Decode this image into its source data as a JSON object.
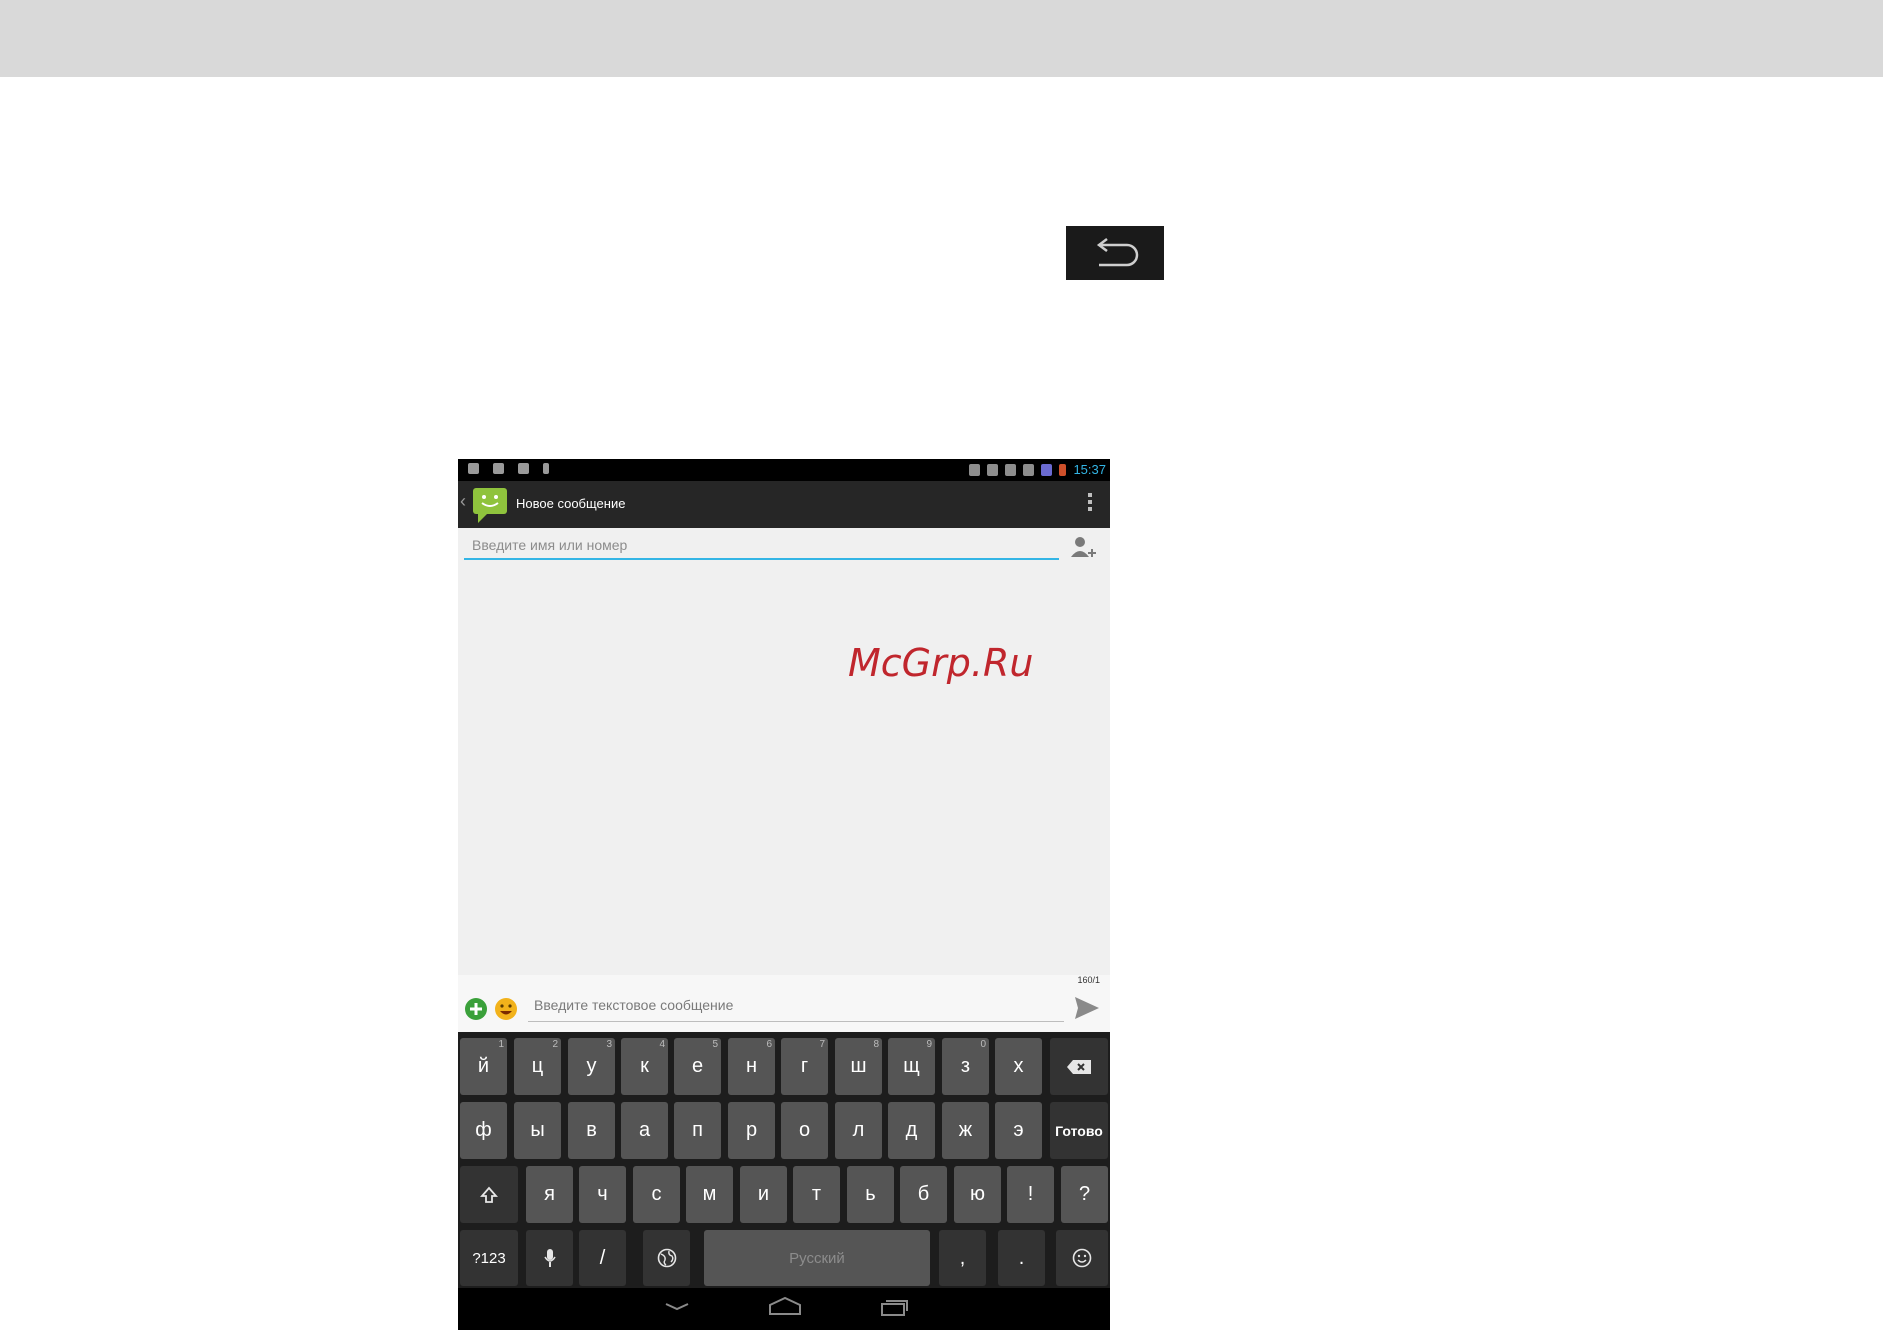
{
  "action_bar": {
    "title": "Новое сообщение"
  },
  "status_bar": {
    "time": "15:37"
  },
  "recipient": {
    "placeholder": "Введите имя или номер"
  },
  "watermark": "McGrp.Ru",
  "compose": {
    "placeholder": "Введите текстовое сообщение",
    "counter": "160/1"
  },
  "keyboard": {
    "row1": [
      {
        "label": "й",
        "hint": "1"
      },
      {
        "label": "ц",
        "hint": "2"
      },
      {
        "label": "у",
        "hint": "3"
      },
      {
        "label": "к",
        "hint": "4"
      },
      {
        "label": "е",
        "hint": "5"
      },
      {
        "label": "н",
        "hint": "6"
      },
      {
        "label": "г",
        "hint": "7"
      },
      {
        "label": "ш",
        "hint": "8"
      },
      {
        "label": "щ",
        "hint": "9"
      },
      {
        "label": "з",
        "hint": "0"
      },
      {
        "label": "х",
        "hint": ""
      }
    ],
    "row2": [
      "ф",
      "ы",
      "в",
      "а",
      "п",
      "р",
      "о",
      "л",
      "д",
      "ж",
      "э"
    ],
    "done_label": "Готово",
    "row3": [
      "я",
      "ч",
      "с",
      "м",
      "и",
      "т",
      "ь",
      "б",
      "ю",
      "!",
      "?"
    ],
    "symbols_label": "?123",
    "slash_label": "/",
    "space_label": "Русский",
    "comma_label": ",",
    "period_label": "."
  },
  "colors": {
    "accent": "#33b5e5",
    "watermark": "#c0262d",
    "key": "#555555",
    "key_func": "#333333"
  },
  "icons": [
    "back-arrow-icon",
    "messaging-app-icon",
    "overflow-menu-icon",
    "add-contact-icon",
    "attach-plus-icon",
    "emoji-icon",
    "send-icon",
    "backspace-icon",
    "shift-icon",
    "microphone-icon",
    "globe-icon",
    "smiley-icon",
    "nav-back-icon",
    "nav-home-icon",
    "nav-recents-icon"
  ]
}
